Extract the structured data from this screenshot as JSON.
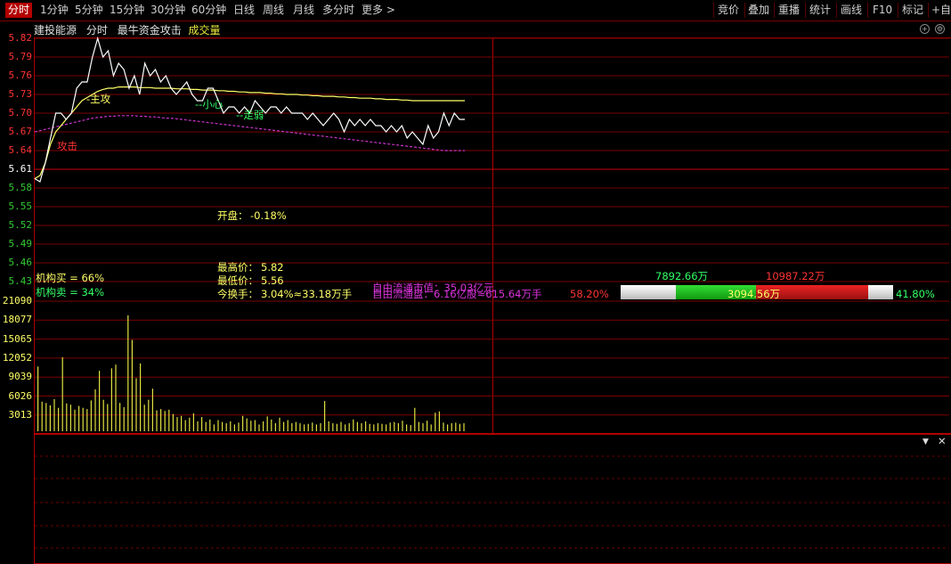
{
  "toolbar": {
    "left": [
      "分时",
      "1分钟",
      "5分钟",
      "15分钟",
      "30分钟",
      "60分钟",
      "日线",
      "周线",
      "月线",
      "多分时",
      "更多 >"
    ],
    "right": [
      "竞价",
      "叠加",
      "重播",
      "统计",
      "画线",
      "F10",
      "标记",
      "+自选"
    ]
  },
  "header": {
    "stock_name": "建投能源",
    "mode": "分时",
    "indicator": "最牛资金攻击",
    "volume_label": "成交量"
  },
  "price_axis": [
    "5.82",
    "5.79",
    "5.76",
    "5.73",
    "5.70",
    "5.67",
    "5.64",
    "5.61",
    "5.58",
    "5.55",
    "5.52",
    "5.49",
    "5.46",
    "5.43"
  ],
  "volume_axis": [
    "21090",
    "18077",
    "15065",
    "12052",
    "9039",
    "6026",
    "3013"
  ],
  "annotations": {
    "attack": "攻击",
    "main_attack": "主攻",
    "careful": "小心",
    "go_weak": "走弱"
  },
  "stats": {
    "open_label": "开盘：",
    "open_value": "-0.18%",
    "high_label": "最高价：",
    "high_value": "5.82",
    "low_label": "最低价：",
    "low_value": "5.56",
    "turnover_label": "今换手：",
    "turnover_value": "3.04%≈33.18万手",
    "inst_buy": "机构买 = 66%",
    "inst_sell": "机构卖 = 34%",
    "free_mcap": "自由流通市值：35.03亿元",
    "free_float": "自由流通盘：6.16亿股≈615.64万手"
  },
  "flow": {
    "left_pct": "58.20%",
    "right_pct": "41.80%",
    "buy_amount": "7892.66万",
    "sell_amount": "10987.22万",
    "net_amount": "3094.56万"
  },
  "colors": {
    "up": "#ff3333",
    "down": "#33cc33",
    "price_line": "#ffffff",
    "avg_line": "#ffff66",
    "ma_line": "#cc33cc",
    "grid": "#8a0000"
  },
  "chart_data": {
    "type": "line",
    "title": "建投能源 分时",
    "ylim": [
      5.43,
      5.82
    ],
    "series": [
      {
        "name": "price",
        "values": [
          5.595,
          5.59,
          5.62,
          5.66,
          5.7,
          5.7,
          5.69,
          5.7,
          5.74,
          5.75,
          5.75,
          5.79,
          5.82,
          5.79,
          5.8,
          5.76,
          5.78,
          5.77,
          5.74,
          5.76,
          5.73,
          5.78,
          5.76,
          5.77,
          5.75,
          5.76,
          5.74,
          5.73,
          5.74,
          5.75,
          5.73,
          5.72,
          5.72,
          5.74,
          5.74,
          5.72,
          5.7,
          5.71,
          5.71,
          5.7,
          5.71,
          5.7,
          5.72,
          5.71,
          5.7,
          5.71,
          5.71,
          5.7,
          5.71,
          5.7,
          5.7,
          5.7,
          5.69,
          5.7,
          5.69,
          5.68,
          5.69,
          5.7,
          5.69,
          5.67,
          5.69,
          5.68,
          5.69,
          5.68,
          5.69,
          5.68,
          5.68,
          5.67,
          5.68,
          5.67,
          5.68,
          5.66,
          5.67,
          5.66,
          5.65,
          5.68,
          5.66,
          5.67,
          5.7,
          5.68,
          5.7,
          5.69,
          5.69
        ]
      },
      {
        "name": "avg",
        "values": [
          5.595,
          5.6,
          5.62,
          5.65,
          5.67,
          5.68,
          5.69,
          5.7,
          5.71,
          5.72,
          5.725,
          5.73,
          5.735,
          5.738,
          5.74,
          5.74,
          5.742,
          5.742,
          5.742,
          5.742,
          5.741,
          5.741,
          5.741,
          5.74,
          5.74,
          5.74,
          5.74,
          5.739,
          5.739,
          5.739,
          5.738,
          5.738,
          5.737,
          5.737,
          5.737,
          5.736,
          5.736,
          5.735,
          5.735,
          5.734,
          5.734,
          5.733,
          5.733,
          5.733,
          5.732,
          5.732,
          5.731,
          5.731,
          5.73,
          5.73,
          5.73,
          5.729,
          5.729,
          5.728,
          5.728,
          5.727,
          5.727,
          5.727,
          5.726,
          5.726,
          5.725,
          5.725,
          5.724,
          5.724,
          5.724,
          5.723,
          5.723,
          5.722,
          5.722,
          5.722,
          5.721,
          5.721,
          5.72,
          5.72,
          5.72,
          5.72,
          5.72,
          5.72,
          5.72,
          5.72,
          5.72,
          5.72,
          5.72
        ]
      },
      {
        "name": "ma",
        "values": [
          5.67,
          5.672,
          5.674,
          5.676,
          5.678,
          5.68,
          5.682,
          5.684,
          5.686,
          5.688,
          5.69,
          5.692,
          5.693,
          5.694,
          5.695,
          5.695,
          5.696,
          5.696,
          5.696,
          5.696,
          5.695,
          5.695,
          5.694,
          5.694,
          5.693,
          5.692,
          5.692,
          5.691,
          5.69,
          5.689,
          5.688,
          5.687,
          5.686,
          5.685,
          5.684,
          5.683,
          5.682,
          5.681,
          5.68,
          5.679,
          5.678,
          5.677,
          5.676,
          5.675,
          5.674,
          5.673,
          5.672,
          5.671,
          5.67,
          5.669,
          5.668,
          5.667,
          5.666,
          5.665,
          5.664,
          5.663,
          5.662,
          5.661,
          5.66,
          5.659,
          5.658,
          5.657,
          5.656,
          5.655,
          5.654,
          5.653,
          5.652,
          5.651,
          5.65,
          5.649,
          5.648,
          5.647,
          5.646,
          5.645,
          5.644,
          5.643,
          5.642,
          5.641,
          5.64,
          5.64,
          5.64,
          5.64,
          5.64
        ]
      }
    ],
    "volume": [
      10500,
      4800,
      4600,
      4200,
      5200,
      3800,
      12000,
      4500,
      4300,
      3500,
      4100,
      3800,
      3600,
      5000,
      6800,
      9800,
      5100,
      4400,
      10200,
      10800,
      4600,
      3900,
      18800,
      14800,
      8600,
      11000,
      4300,
      5100,
      6900,
      3400,
      3600,
      3300,
      3500,
      2800,
      2300,
      2500,
      1800,
      2200,
      2900,
      1600,
      2300,
      1500,
      1900,
      1100,
      1800,
      1500,
      1300,
      1600,
      1100,
      1400,
      2500,
      2100,
      1700,
      1800,
      1100,
      1600,
      2400,
      1900,
      1300,
      2200,
      1500,
      1800,
      1300,
      1500,
      1300,
      1100,
      1200,
      1400,
      1100,
      1300,
      4900,
      1600,
      1300,
      1200,
      1500,
      1100,
      1300,
      1900,
      1500,
      1300,
      1600,
      1200,
      1100,
      1300,
      1200,
      1100,
      1400,
      1500,
      1300,
      1700,
      1100,
      1000,
      3800,
      1500,
      1300,
      1700,
      1100,
      3000,
      3200,
      1400,
      1100,
      1300,
      1400,
      1200,
      1300
    ]
  }
}
